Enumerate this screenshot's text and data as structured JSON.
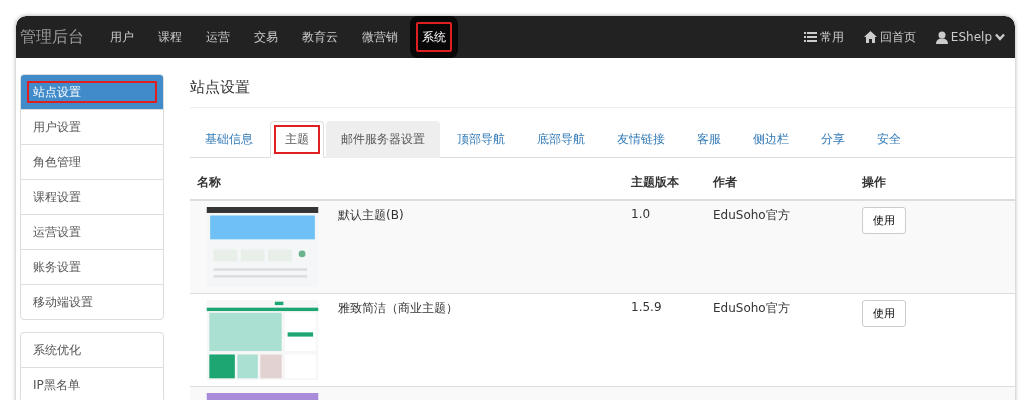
{
  "navbar": {
    "brand": "管理后台",
    "items": [
      {
        "label": "用户",
        "selected": false
      },
      {
        "label": "课程",
        "selected": false
      },
      {
        "label": "运营",
        "selected": false
      },
      {
        "label": "交易",
        "selected": false
      },
      {
        "label": "教育云",
        "selected": false
      },
      {
        "label": "微营销",
        "selected": false
      },
      {
        "label": "系统",
        "selected": true
      }
    ],
    "right_items": [
      {
        "kind": "list",
        "label": "常用"
      },
      {
        "kind": "home",
        "label": "回首页"
      },
      {
        "kind": "user",
        "label": "EShelp"
      }
    ]
  },
  "sidebar": {
    "groups": [
      [
        {
          "label": "站点设置",
          "selected": true
        },
        {
          "label": "用户设置",
          "selected": false
        },
        {
          "label": "角色管理",
          "selected": false
        },
        {
          "label": "课程设置",
          "selected": false
        },
        {
          "label": "运营设置",
          "selected": false
        },
        {
          "label": "账务设置",
          "selected": false
        },
        {
          "label": "移动端设置",
          "selected": false
        }
      ],
      [
        {
          "label": "系统优化",
          "selected": false
        },
        {
          "label": "IP黑名单",
          "selected": false
        }
      ]
    ]
  },
  "page_title": "站点设置",
  "tabs": [
    {
      "label": "基础信息",
      "selected": false,
      "hover": false
    },
    {
      "label": "主题",
      "selected": true,
      "hover": false
    },
    {
      "label": "邮件服务器设置",
      "selected": false,
      "hover": true
    },
    {
      "label": "顶部导航",
      "selected": false,
      "hover": false
    },
    {
      "label": "底部导航",
      "selected": false,
      "hover": false
    },
    {
      "label": "友情链接",
      "selected": false,
      "hover": false
    },
    {
      "label": "客服",
      "selected": false,
      "hover": false
    },
    {
      "label": "侧边栏",
      "selected": false,
      "hover": false
    },
    {
      "label": "分享",
      "selected": false,
      "hover": false
    },
    {
      "label": "安全",
      "selected": false,
      "hover": false
    }
  ],
  "table": {
    "columns": [
      "名称",
      "主题版本",
      "作者",
      "操作"
    ],
    "rows": [
      {
        "kind": "blue",
        "name": "默认主题(B)",
        "version": "1.0",
        "author": "EduSoho官方",
        "action": "使用"
      },
      {
        "kind": "green",
        "name": "雅致简洁（商业主题）",
        "version": "1.5.9",
        "author": "EduSoho官方",
        "action": "使用"
      },
      {
        "kind": "purple"
      }
    ]
  }
}
